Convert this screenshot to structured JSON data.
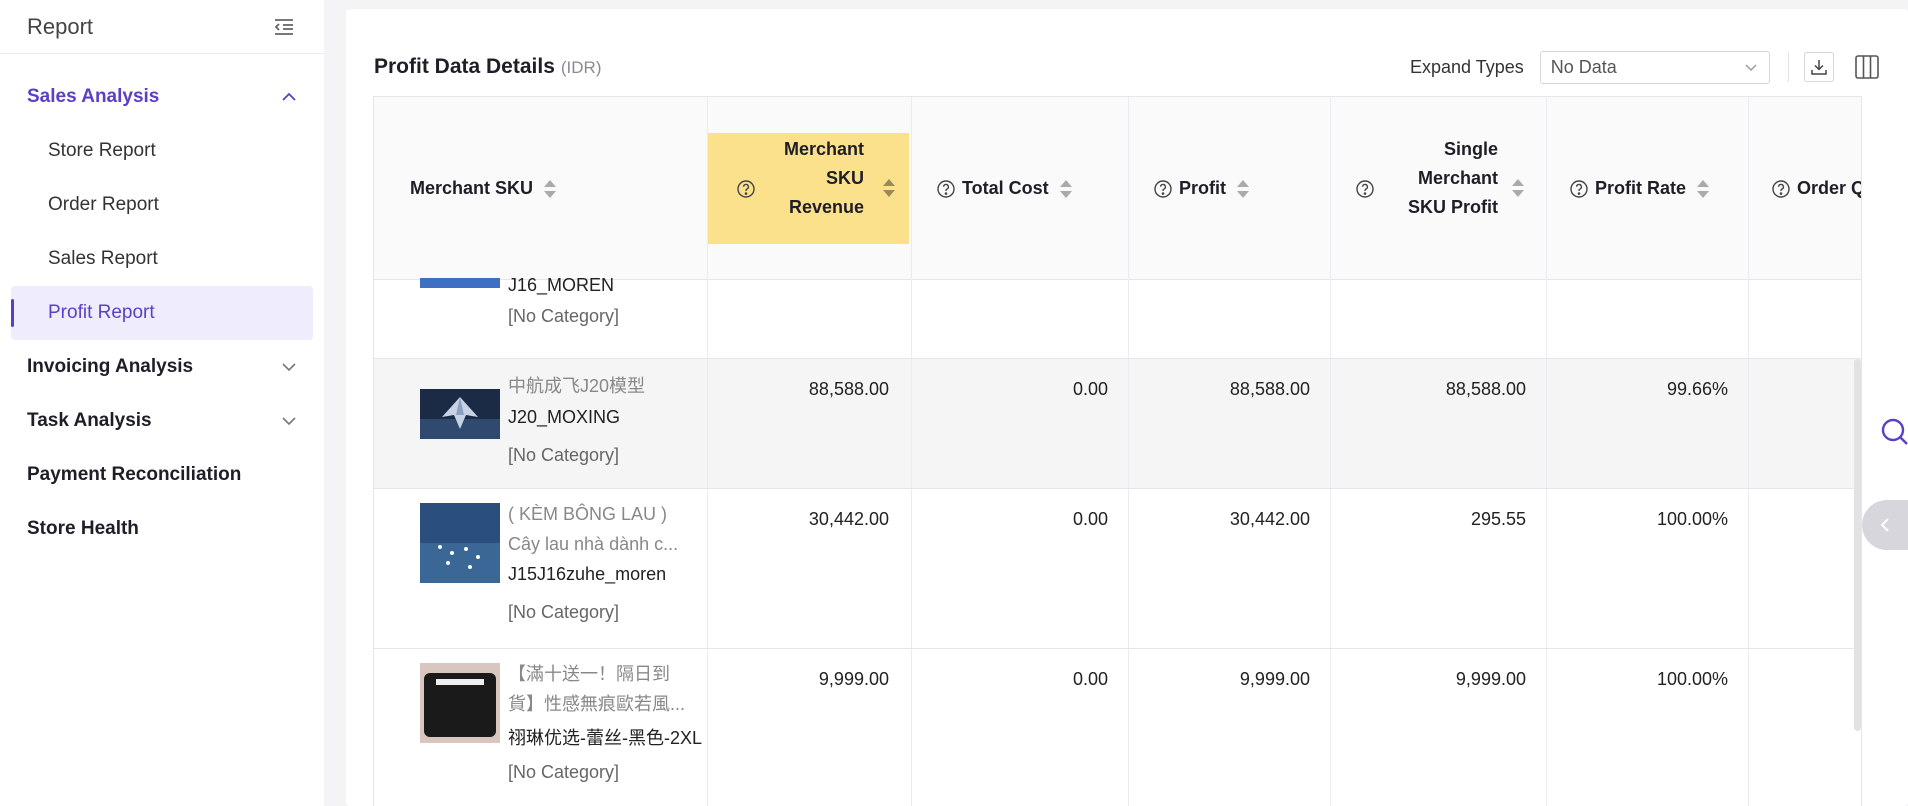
{
  "sidebar": {
    "title": "Report",
    "menu": [
      {
        "label": "Sales Analysis",
        "expanded": true,
        "children": [
          "Store Report",
          "Order Report",
          "Sales Report",
          "Profit Report"
        ],
        "selected": "Profit Report"
      },
      {
        "label": "Invoicing Analysis"
      },
      {
        "label": "Task Analysis"
      },
      {
        "label": "Payment Reconciliation"
      },
      {
        "label": "Store Health"
      }
    ]
  },
  "toolbar": {
    "title": "Profit Data Details",
    "currency": "(IDR)",
    "expand_label": "Expand Types",
    "expand_value": "No Data"
  },
  "table": {
    "columns": [
      {
        "lines": [
          "Merchant SKU"
        ]
      },
      {
        "lines": [
          "Merchant",
          "SKU",
          "Revenue"
        ]
      },
      {
        "lines": [
          "Total Cost"
        ]
      },
      {
        "lines": [
          "Profit"
        ]
      },
      {
        "lines": [
          "Single",
          "Merchant",
          "SKU Profit"
        ]
      },
      {
        "lines": [
          "Profit Rate"
        ]
      },
      {
        "lines": [
          "Order Q"
        ]
      }
    ],
    "partial_row": {
      "sku": "J16_MOREN",
      "category": "[No Category]"
    },
    "rows": [
      {
        "name": [
          "中航成飞J20模型"
        ],
        "sku": "J20_MOXING",
        "category": "[No Category]",
        "revenue": "88,588.00",
        "cost": "0.00",
        "profit": "88,588.00",
        "single_profit": "88,588.00",
        "rate": "99.66%"
      },
      {
        "name": [
          "( KÈM BÔNG LAU )",
          "Cây lau nhà dành c..."
        ],
        "sku": "J15J16zuhe_moren",
        "category": "[No Category]",
        "revenue": "30,442.00",
        "cost": "0.00",
        "profit": "30,442.00",
        "single_profit": "295.55",
        "rate": "100.00%"
      },
      {
        "name": [
          "【滿十送一！隔日到",
          "貨】性感無痕歐若風..."
        ],
        "sku": "祤琳优选-蕾丝-黑色-2XL",
        "category": "[No Category]",
        "revenue": "9,999.00",
        "cost": "0.00",
        "profit": "9,999.00",
        "single_profit": "9,999.00",
        "rate": "100.00%"
      }
    ]
  },
  "colors": {
    "accent": "#5b3fc4",
    "highlight": "#fbe18b"
  },
  "icons": [
    "menu-collapse-icon",
    "chevron-up-icon",
    "chevron-down-icon",
    "help-circle-icon",
    "sort-icon",
    "download-icon",
    "columns-icon",
    "search-icon",
    "chevron-left-icon"
  ]
}
